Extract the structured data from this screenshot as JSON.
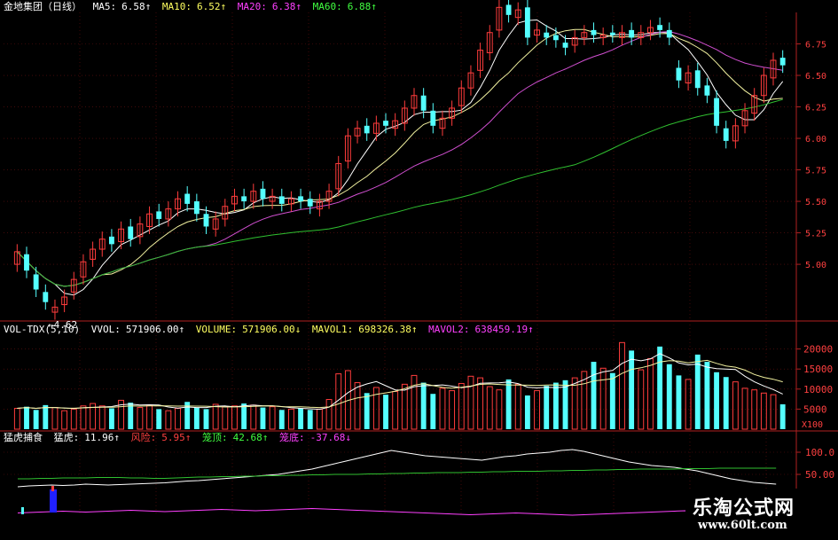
{
  "colors": {
    "up": "#ff3c3c",
    "down": "#54ffff",
    "ma5": "#ffffff",
    "ma10": "#f2f2a0",
    "ma20": "#d04fd0",
    "ma60": "#30c030",
    "axis": "#b02020",
    "grid": "#6a1010",
    "yellow": "#ffff00",
    "magenta": "#ff40ff",
    "green": "#40ff40",
    "red": "#ff4040",
    "white": "#ffffff"
  },
  "price_header": {
    "name": "金地集团（日线）",
    "ma5_label": "MA5:",
    "ma5_value": "6.58↑",
    "ma10_label": "MA10:",
    "ma10_value": "6.52↑",
    "ma20_label": "MA20:",
    "ma20_value": "6.38↑",
    "ma60_label": "MA60:",
    "ma60_value": "6.88↑"
  },
  "vol_header": {
    "name": "VOL-TDX(5,10)",
    "vvol_label": "VVOL:",
    "vvol_value": "571906.00↑",
    "volume_label": "VOLUME:",
    "volume_value": "571906.00↓",
    "mavol1_label": "MAVOL1:",
    "mavol1_value": "698326.38↑",
    "mavol2_label": "MAVOL2:",
    "mavol2_value": "638459.19↑"
  },
  "ind_header": {
    "name": "猛虎捕食",
    "tiger_label": "猛虎:",
    "tiger_value": "11.96↑",
    "risk_label": "风险:",
    "risk_value": "5.95↑",
    "top_label": "笼顶:",
    "top_value": "42.68↑",
    "bottom_label": "笼底:",
    "bottom_value": "-37.68↓"
  },
  "watermark": {
    "title": "乐淘公式网",
    "url": "www.60lt.com"
  },
  "chart_data": [
    {
      "type": "candlestick",
      "y_ticks": [
        "6.75",
        "6.50",
        "6.25",
        "6.00",
        "5.75",
        "5.50",
        "5.25",
        "5.00"
      ],
      "ylim": [
        4.55,
        7.0
      ],
      "annotation": "←4.62",
      "annotation_value": 4.62,
      "n": 82,
      "series": [
        {
          "name": "MA5"
        },
        {
          "name": "MA10"
        },
        {
          "name": "MA20"
        },
        {
          "name": "MA60"
        }
      ],
      "close": [
        5.1,
        4.95,
        4.8,
        4.7,
        4.66,
        4.74,
        4.88,
        5.02,
        5.12,
        5.2,
        5.16,
        5.28,
        5.2,
        5.32,
        5.4,
        5.36,
        5.44,
        5.52,
        5.48,
        5.4,
        5.3,
        5.36,
        5.46,
        5.54,
        5.5,
        5.58,
        5.52,
        5.54,
        5.48,
        5.52,
        5.5,
        5.46,
        5.5,
        5.58,
        5.8,
        6.02,
        6.08,
        6.04,
        6.12,
        6.1,
        6.14,
        6.24,
        6.34,
        6.22,
        6.1,
        6.16,
        6.24,
        6.4,
        6.52,
        6.7,
        6.84,
        7.04,
        6.98,
        7.02,
        6.8,
        6.86,
        6.8,
        6.78,
        6.72,
        6.8,
        6.84,
        6.82,
        6.82,
        6.82,
        6.84,
        6.8,
        6.84,
        6.88,
        6.86,
        6.8,
        6.46,
        6.52,
        6.4,
        6.34,
        6.1,
        5.98,
        6.1,
        6.22,
        6.34,
        6.5,
        6.62,
        6.58
      ],
      "open": [
        5.0,
        5.08,
        4.92,
        4.78,
        4.62,
        4.68,
        4.78,
        4.9,
        5.04,
        5.12,
        5.22,
        5.18,
        5.3,
        5.22,
        5.3,
        5.42,
        5.36,
        5.44,
        5.56,
        5.5,
        5.4,
        5.28,
        5.36,
        5.48,
        5.54,
        5.5,
        5.6,
        5.5,
        5.54,
        5.48,
        5.54,
        5.52,
        5.44,
        5.5,
        5.6,
        5.82,
        6.02,
        6.1,
        6.04,
        6.14,
        6.08,
        6.12,
        6.24,
        6.34,
        6.22,
        6.08,
        6.16,
        6.26,
        6.4,
        6.54,
        6.68,
        6.86,
        7.06,
        6.96,
        7.04,
        6.82,
        6.84,
        6.82,
        6.76,
        6.74,
        6.8,
        6.86,
        6.8,
        6.84,
        6.8,
        6.86,
        6.8,
        6.84,
        6.9,
        6.86,
        6.56,
        6.44,
        6.54,
        6.42,
        6.32,
        6.08,
        5.98,
        6.1,
        6.2,
        6.34,
        6.48,
        6.64
      ],
      "volume": [
        5200,
        5600,
        4800,
        6000,
        5400,
        4600,
        5000,
        5800,
        6400,
        5800,
        5200,
        7200,
        6600,
        5400,
        6000,
        5000,
        4600,
        5200,
        6800,
        5400,
        5000,
        6200,
        5600,
        5800,
        6400,
        6000,
        5400,
        5600,
        4800,
        5000,
        5200,
        4800,
        5000,
        7400,
        13800,
        14600,
        11600,
        9000,
        10400,
        8600,
        9400,
        11200,
        13400,
        11600,
        8800,
        10200,
        9600,
        11400,
        13200,
        12800,
        10600,
        9800,
        12400,
        11200,
        8400,
        9600,
        10800,
        11600,
        12200,
        12800,
        14400,
        16800,
        15200,
        14000,
        21600,
        19600,
        14800,
        17600,
        20600,
        16200,
        13400,
        12400,
        18600,
        16800,
        14200,
        13000,
        11800,
        10200,
        9800,
        9000,
        8600,
        6200
      ],
      "mavol_ylim": [
        0,
        23000
      ],
      "vol_y_ticks": [
        "20000",
        "15000",
        "10000",
        "5000"
      ],
      "vol_axis_unit": "X100",
      "tiger": [
        22,
        24,
        25,
        26,
        25,
        26,
        28,
        27,
        26,
        27,
        28,
        29,
        30,
        31,
        33,
        35,
        36,
        38,
        40,
        42,
        44,
        46,
        48,
        50,
        54,
        58,
        62,
        68,
        74,
        80,
        86,
        92,
        98,
        104,
        100,
        96,
        92,
        90,
        88,
        86,
        84,
        82,
        86,
        90,
        92,
        96,
        98,
        100,
        104,
        106,
        102,
        96,
        90,
        84,
        78,
        74,
        70,
        68,
        66,
        62,
        58,
        52,
        46,
        40,
        36,
        32,
        30,
        28
      ],
      "lid": [
        40,
        40,
        41,
        41,
        42,
        42,
        42,
        43,
        43,
        43,
        42,
        42,
        41,
        41,
        42,
        43,
        44,
        44,
        45,
        45,
        46,
        46,
        47,
        47,
        48,
        48,
        49,
        49,
        50,
        50,
        50,
        51,
        51,
        52,
        52,
        53,
        53,
        54,
        54,
        54,
        55,
        55,
        56,
        56,
        57,
        57,
        57,
        58,
        58,
        59,
        59,
        60,
        60,
        61,
        61,
        62,
        62,
        62,
        62,
        63,
        63,
        63,
        64,
        64,
        64,
        64,
        64,
        64
      ],
      "floor": [
        -37,
        -36,
        -35,
        -34,
        -33,
        -34,
        -35,
        -34,
        -33,
        -32,
        -31,
        -32,
        -33,
        -34,
        -33,
        -32,
        -31,
        -30,
        -29,
        -30,
        -31,
        -32,
        -31,
        -30,
        -29,
        -28,
        -27,
        -28,
        -29,
        -30,
        -31,
        -32,
        -33,
        -34,
        -35,
        -36,
        -37,
        -38,
        -39,
        -40,
        -41,
        -40,
        -39,
        -38,
        -37,
        -38,
        -39,
        -40,
        -41,
        -42,
        -41,
        -40,
        -39,
        -38,
        -37,
        -36,
        -35,
        -34,
        -33,
        -32,
        -33,
        -34,
        -35,
        -36,
        -37,
        -38,
        -38,
        -38
      ],
      "ind_y_ticks": [
        "100.0",
        "50.00"
      ]
    }
  ]
}
